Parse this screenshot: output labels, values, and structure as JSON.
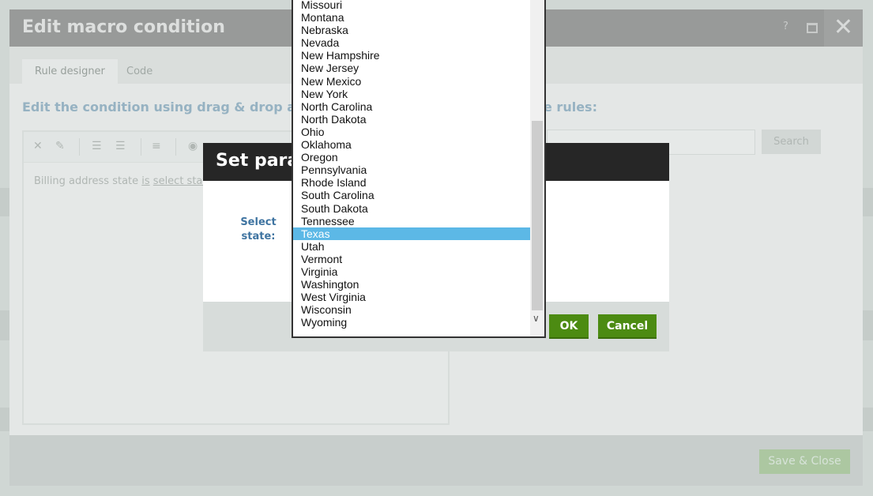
{
  "macro_dialog": {
    "title": "Edit macro condition",
    "help_label": "?",
    "close_glyph": "✕",
    "tabs": [
      {
        "label": "Rule designer",
        "active": true
      },
      {
        "label": "Code",
        "active": false
      }
    ],
    "instructions": "Edit the condition using drag & drop and",
    "instructions_right": "e rules:",
    "rule_text": {
      "prefix": "Billing address state ",
      "operator": "is",
      "value": "select state"
    },
    "search_button": "Search",
    "save_close_button": "Save & Close"
  },
  "param_dialog": {
    "title": "Set parar",
    "label_line1": "Select",
    "label_line2": "state:",
    "ok_label": "OK",
    "cancel_label": "Cancel"
  },
  "dropdown": {
    "selected": "Texas",
    "items": [
      "Missouri",
      "Montana",
      "Nebraska",
      "Nevada",
      "New Hampshire",
      "New Jersey",
      "New Mexico",
      "New York",
      "North Carolina",
      "North Dakota",
      "Ohio",
      "Oklahoma",
      "Oregon",
      "Pennsylvania",
      "Rhode Island",
      "South Carolina",
      "South Dakota",
      "Tennessee",
      "Texas",
      "Utah",
      "Vermont",
      "Virginia",
      "Washington",
      "West Virginia",
      "Wisconsin",
      "Wyoming"
    ]
  },
  "colors": {
    "accent_green": "#4c8b12",
    "selection_blue": "#5cb8e6"
  }
}
